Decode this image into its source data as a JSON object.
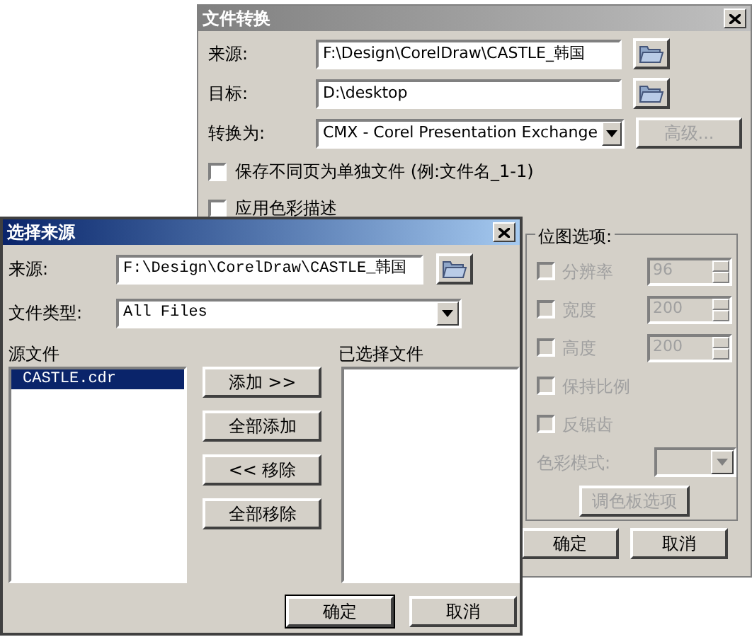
{
  "main_window": {
    "title": "文件转换",
    "active": false,
    "fields": [
      {
        "kind": "browse",
        "label": "来源:",
        "value": "F:\\Design\\CorelDraw\\CASTLE_韩国"
      },
      {
        "kind": "browse",
        "label": "目标:",
        "value": "D:\\desktop"
      },
      {
        "kind": "dropdown",
        "label": "转换为:",
        "value": "CMX - Corel Presentation Exchange",
        "button": "高级...",
        "button_disabled": true
      }
    ],
    "options": [
      {
        "label": "保存不同页为单独文件 (例:文件名_1-1)",
        "checked": false
      },
      {
        "label": "应用色彩描述",
        "checked": false
      }
    ],
    "bitmap_options": {
      "title": "位图选项:",
      "items": [
        {
          "kind": "spin",
          "label": "分辨率",
          "value": "96",
          "checked": false,
          "disabled": true
        },
        {
          "kind": "spin",
          "label": "宽度",
          "value": "200",
          "checked": false,
          "disabled": true
        },
        {
          "kind": "spin",
          "label": "高度",
          "value": "200",
          "checked": false,
          "disabled": true
        },
        {
          "kind": "check",
          "label": "保持比例",
          "checked": false,
          "disabled": true
        },
        {
          "kind": "check",
          "label": "反锯齿",
          "checked": false,
          "disabled": true
        },
        {
          "kind": "dropdown",
          "label": "色彩模式:",
          "disabled": true
        },
        {
          "kind": "button",
          "label": "调色板选项",
          "disabled": true
        }
      ]
    },
    "buttons": [
      "确定",
      "取消"
    ]
  },
  "dialog": {
    "title": "选择来源",
    "active": true,
    "fields": [
      {
        "kind": "browse",
        "label": "来源:",
        "value": "F:\\Design\\CorelDraw\\CASTLE_韩国"
      },
      {
        "kind": "dropdown",
        "label": "文件类型:",
        "value": "All Files"
      }
    ],
    "source_label": "源文件",
    "source_files": [
      {
        "name": "CASTLE.cdr",
        "selected": true
      }
    ],
    "selected_label": "已选择文件",
    "move_buttons": [
      "添加 >>",
      "全部添加",
      "<< 移除",
      "全部移除"
    ],
    "buttons": [
      {
        "label": "确定",
        "default": true
      },
      {
        "label": "取消",
        "default": false
      }
    ]
  }
}
